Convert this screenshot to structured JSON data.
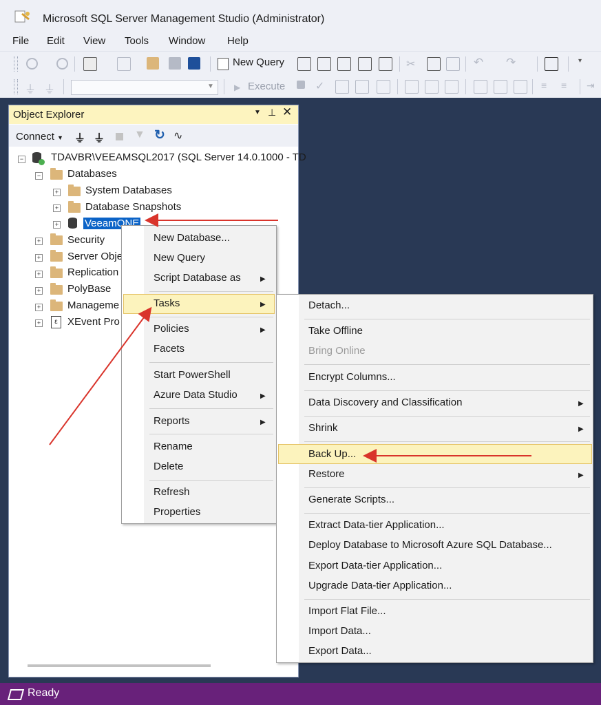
{
  "window": {
    "title": "Microsoft SQL Server Management Studio (Administrator)"
  },
  "menubar": [
    "File",
    "Edit",
    "View",
    "Tools",
    "Window",
    "Help"
  ],
  "toolbar": {
    "new_query": "New Query",
    "execute": "Execute"
  },
  "object_explorer": {
    "title": "Object Explorer",
    "connect": "Connect",
    "tree": {
      "server": "TDAVBR\\VEEAMSQL2017 (SQL Server 14.0.1000 - TD",
      "databases": "Databases",
      "system_databases": "System Databases",
      "database_snapshots": "Database Snapshots",
      "selected_database": "VeeamONE",
      "security": "Security",
      "server_objects": "Server Obje",
      "replication": "Replication",
      "polybase": "PolyBase",
      "management": "Manageme",
      "xevent": "XEvent Pro"
    }
  },
  "context_menu": {
    "new_database": "New Database...",
    "new_query": "New Query",
    "script_database_as": "Script Database as",
    "tasks": "Tasks",
    "policies": "Policies",
    "facets": "Facets",
    "start_powershell": "Start PowerShell",
    "azure_data_studio": "Azure Data Studio",
    "reports": "Reports",
    "rename": "Rename",
    "delete": "Delete",
    "refresh": "Refresh",
    "properties": "Properties"
  },
  "tasks_submenu": {
    "detach": "Detach...",
    "take_offline": "Take Offline",
    "bring_online": "Bring Online",
    "encrypt_columns": "Encrypt Columns...",
    "data_discovery": "Data Discovery and Classification",
    "shrink": "Shrink",
    "back_up": "Back Up...",
    "restore": "Restore",
    "generate_scripts": "Generate Scripts...",
    "extract_dac": "Extract Data-tier Application...",
    "deploy_azure": "Deploy Database to Microsoft Azure SQL Database...",
    "export_dac": "Export Data-tier Application...",
    "upgrade_dac": "Upgrade Data-tier Application...",
    "import_flat_file": "Import Flat File...",
    "import_data": "Import Data...",
    "export_data": "Export Data..."
  },
  "status": {
    "text": "Ready"
  },
  "colors": {
    "status_bar": "#68217a",
    "selection": "#0b63c7",
    "highlight": "#fcf3bd",
    "annotation_arrow": "#d9342b"
  }
}
